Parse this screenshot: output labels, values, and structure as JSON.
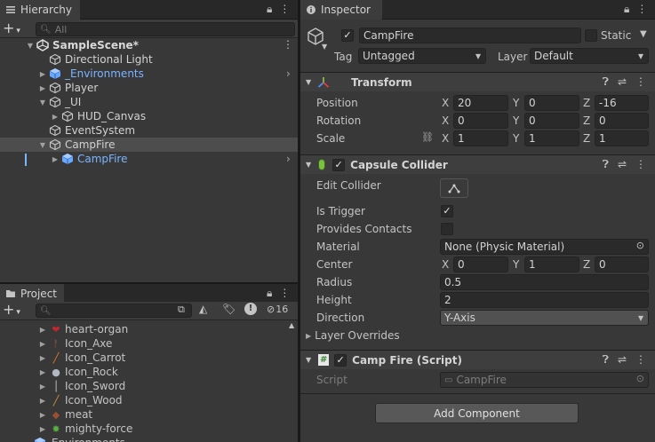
{
  "hierarchy": {
    "tab_label": "Hierarchy",
    "search_placeholder": "All",
    "scene_name": "SampleScene*",
    "items": [
      {
        "label": "Directional Light",
        "depth": 1,
        "arrow": "",
        "icon": "cube-outline-icon",
        "color": "#d2d2d2"
      },
      {
        "label": "_Environments",
        "depth": 1,
        "arrow": "▶",
        "icon": "prefab-cube-icon",
        "color": "#7bb4ff"
      },
      {
        "label": "Player",
        "depth": 1,
        "arrow": "▶",
        "icon": "cube-outline-icon",
        "color": "#d2d2d2"
      },
      {
        "label": "_UI",
        "depth": 1,
        "arrow": "▼",
        "icon": "cube-outline-icon",
        "color": "#d2d2d2"
      },
      {
        "label": "HUD_Canvas",
        "depth": 2,
        "arrow": "▶",
        "icon": "cube-outline-icon",
        "color": "#d2d2d2"
      },
      {
        "label": "EventSystem",
        "depth": 1,
        "arrow": "",
        "icon": "cube-outline-icon",
        "color": "#d2d2d2"
      },
      {
        "label": "CampFire",
        "depth": 1,
        "arrow": "▼",
        "icon": "cube-outline-icon",
        "color": "#d2d2d2"
      },
      {
        "label": "CampFire",
        "depth": 2,
        "arrow": "▶",
        "icon": "prefab-cube-icon",
        "color": "#7bb4ff"
      }
    ]
  },
  "project": {
    "tab_label": "Project",
    "hidden_count": "16",
    "items": [
      {
        "label": "heart-organ",
        "icon": "heart-icon",
        "icon_color": "#c0282e"
      },
      {
        "label": "Icon_Axe",
        "icon": "axe-icon",
        "icon_color": "#a06040"
      },
      {
        "label": "Icon_Carrot",
        "icon": "carrot-icon",
        "icon_color": "#e07a20"
      },
      {
        "label": "Icon_Rock",
        "icon": "rock-icon",
        "icon_color": "#b0b8c0"
      },
      {
        "label": "Icon_Sword",
        "icon": "sword-icon",
        "icon_color": "#c8c8c8"
      },
      {
        "label": "Icon_Wood",
        "icon": "wood-icon",
        "icon_color": "#d09040"
      },
      {
        "label": "meat",
        "icon": "meat-icon",
        "icon_color": "#9a5030"
      },
      {
        "label": "mighty-force",
        "icon": "force-icon",
        "icon_color": "#5ab040"
      },
      {
        "label": "Environments",
        "icon": "prefab-cube-icon",
        "icon_color": "#7bb4ff"
      }
    ]
  },
  "inspector": {
    "tab_label": "Inspector",
    "object_name": "CampFire",
    "static_label": "Static",
    "tag_label": "Tag",
    "tag_value": "Untagged",
    "layer_label": "Layer",
    "layer_value": "Default",
    "transform": {
      "title": "Transform",
      "position_label": "Position",
      "rotation_label": "Rotation",
      "scale_label": "Scale",
      "position": {
        "x": "20",
        "y": "0",
        "z": "-16"
      },
      "rotation": {
        "x": "0",
        "y": "0",
        "z": "0"
      },
      "scale": {
        "x": "1",
        "y": "1",
        "z": "1"
      },
      "axis_x": "X",
      "axis_y": "Y",
      "axis_z": "Z"
    },
    "collider": {
      "title": "Capsule Collider",
      "edit_collider_label": "Edit Collider",
      "is_trigger_label": "Is Trigger",
      "is_trigger_checked": true,
      "provides_contacts_label": "Provides Contacts",
      "material_label": "Material",
      "material_value": "None (Physic Material)",
      "center_label": "Center",
      "center": {
        "x": "0",
        "y": "1",
        "z": "0"
      },
      "radius_label": "Radius",
      "radius_value": "0.5",
      "height_label": "Height",
      "height_value": "2",
      "direction_label": "Direction",
      "direction_value": "Y-Axis",
      "layer_overrides_label": "Layer Overrides"
    },
    "script": {
      "title": "Camp Fire (Script)",
      "script_label": "Script",
      "script_value": "CampFire"
    },
    "add_component_label": "Add Component"
  },
  "colors": {
    "accent": "#7bb4ff",
    "panel_bg": "#383838",
    "header_bg": "#3e3e3e"
  }
}
